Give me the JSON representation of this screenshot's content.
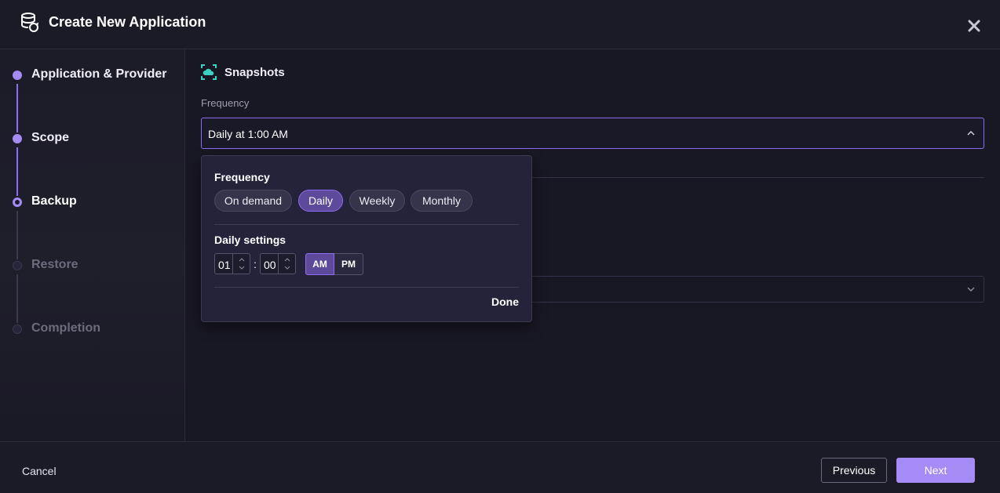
{
  "header": {
    "title": "Create New Application",
    "icon": "database-sync-icon",
    "close_icon": "close-icon"
  },
  "steps": [
    {
      "label": "Application & Provider",
      "state": "completed"
    },
    {
      "label": "Scope",
      "state": "completed"
    },
    {
      "label": "Backup",
      "state": "current"
    },
    {
      "label": "Restore",
      "state": "upcoming"
    },
    {
      "label": "Completion",
      "state": "upcoming"
    }
  ],
  "main": {
    "section_title": "Snapshots",
    "section_icon": "cloud-snapshot-icon",
    "frequency_label": "Frequency",
    "frequency_value": "Daily at 1:00 AM"
  },
  "popup": {
    "frequency_title": "Frequency",
    "options": [
      "On demand",
      "Daily",
      "Weekly",
      "Monthly"
    ],
    "selected_option": "Daily",
    "daily_title": "Daily settings",
    "hour": "01",
    "minute": "00",
    "separator": ":",
    "am_label": "AM",
    "pm_label": "PM",
    "period": "AM",
    "done_label": "Done"
  },
  "footer": {
    "cancel_label": "Cancel",
    "previous_label": "Previous",
    "next_label": "Next"
  },
  "colors": {
    "accent": "#8c6cf0",
    "next_button": "#a58bf5",
    "background": "#181724",
    "snapshot_icon": "#3ad1c4"
  }
}
